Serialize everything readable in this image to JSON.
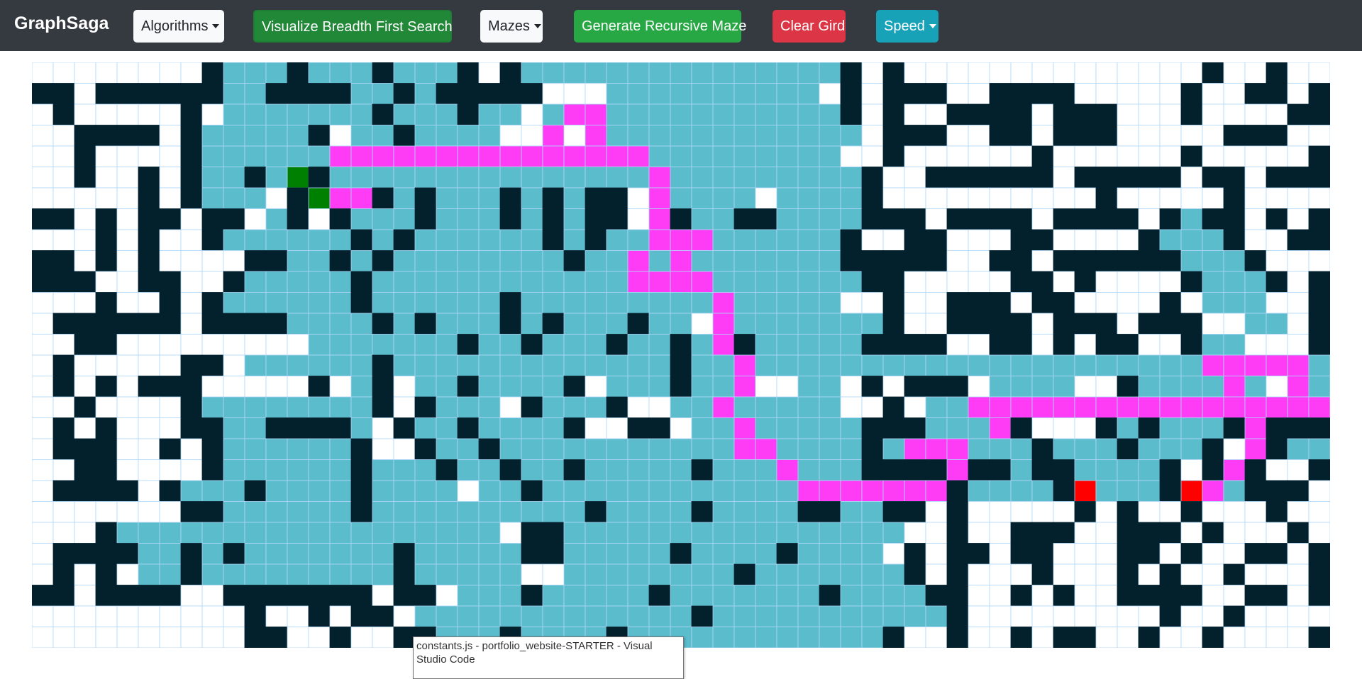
{
  "navbar": {
    "brand": "GraphSaga",
    "algorithms_label": "Algorithms",
    "visualize_label": "Visualize Breadth First Search",
    "mazes_label": "Mazes",
    "generate_label": "Generate Recursive Maze",
    "clear_label": "Clear Gird",
    "speed_label": "Speed"
  },
  "grid": {
    "rows": 28,
    "cols": 61,
    "colors": {
      "empty": "#ffffff",
      "wall": "#03212d",
      "visited": "#5bbccc",
      "path": "#ff3cf5",
      "start": "#008000",
      "target": "#ff0000",
      "border": "#afd8f8"
    },
    "start": [
      5,
      12
    ],
    "target": [
      20,
      49
    ],
    "legend": {
      ".": "empty",
      "#": "wall",
      "v": "visited",
      "p": "path",
      "S": "start",
      "T": "target"
    },
    "cells": [
      "........#vvv#vvv#vvv#.#vvvvvvvvvvvvvvv#.#..............#..#...#",
      "##.######vv####vv#v#####...vvvvvvvvvv.#.###..####.....#..##.##.",
      ".#.....#.vvvvvvv#vvv#vv.vppvvvvvvvvvvv#.#..####.###...#....###..",
      "..####.#vvvvv#.vv#vvvv..p.pvvvvvvvvvvvv.###..##.###.....###...##",
      "..#....#vvvvvvpppppppppppppppvvvvvvvvv..#......#......#.....#..#",
      "..#..#.#vv#vv#vvvvvvvvvvvvvvvpvvvvvvvvv#..######.#####.##.#####.",
      ".....#.#vvv.#Spp#v#vvv#v#v##.pvvvv.vvvv#..........#.....#......",
      "##.#.##.##.v#.#vvv#vvv#v#v##.p#vv##vvvv###.####.####.#v##.#.#.##",
      "...#.#..#vvvvvv#v#vvvvvv#v#vvpppvvvvvv#..##...##....#vvv#..##.",
      "##.#.#....##vv#v#vvvvvvvv#vvpvpvvvvvvv#####..##.######vvv#...##",
      "###..##..#vvvvv#vvvvvvvvvvvvppppvvvvvvv##.....##.#....#vvv#.##.",
      "...#..#.#vvvvvv#vvvvvv#vvvvvvvvvpvvvvv..#..###.##....#.vvv..##",
      ".######.####vvvv#v#vvv#v#vvv#vv.pvvvvvvv#..####.###.###..vv.##.",
      "..##.........vvvvvvv#vv#vvv#vv#vp#vvvvv####..##.#.##..#vv...##",
      ".#.....##.vvvvvv#vvvvvvvvvvvvv#vvpvvvvvvvvvvvvvvvvvvvvvpppppvv#..",
      ".#.#.###.....#.v#.vv#vvvv#.vvv#vvp..vv.#.###.vvvv..#vvvvpv.pvv.##",
      "..#....#vvvvvvvv#.#vvv.#vvv#..vvpvvvvv..#.vvppppppppppppppppp#..",
      ".#.#...##vv####v.#vv#vvvv#..##.vvpvvvvv###vvvp#...#v#vvv#p####.",
      ".###..#.#vvvvvv#..#vv#vvvvvvvvvvvppvvvv#vpppvvv#vvv#vvv#.p#vv...",
      "..##....#vvvvvv#vvv#vv#vv#vvvvv#vvvpvvv####p##v##vvvv#.#p#..##.#",
      ".####.#vvv#vvvv#vvvv.vv#vvvvvvvvvvvvppppppp#vvvv#vvvv#Tpv###.#.",
      ".......##vvvvvv#vvvvvvvvvv#vvvv#vvvv##vv##.#.....#.#..#...#..##",
      "...#vvvvvvvvvvvvvvvvvv.##vvvvvvvvvvvvvvvv..#..###..###.#...#...",
      ".####vv#v#vvvvvvv#vvvvv##vvvvv#vvvv#vvvv.#.##.##...##.#..##.#..",
      ".#.#.vv#vvvvvvvvv#vvvvv..vvvvvvvv#vvvvvvv#.#...#...#.#..#...#.",
      "##.####..#######.##.vvv#vvvvv#vvvvvvv#vvvv##..#.#..####..##.##",
      "..........#..#.##.vvvvvvvvvvvvv#vvvvvvvvvvv#.........#..#......",
      "..........##..#..##vvv#vvvv#vvvvvvvvvvvv#..#..#.##..#..#....#.."
    ]
  },
  "tooltip": {
    "text": "constants.js - portfolio_website-STARTER - Visual Studio Code"
  }
}
